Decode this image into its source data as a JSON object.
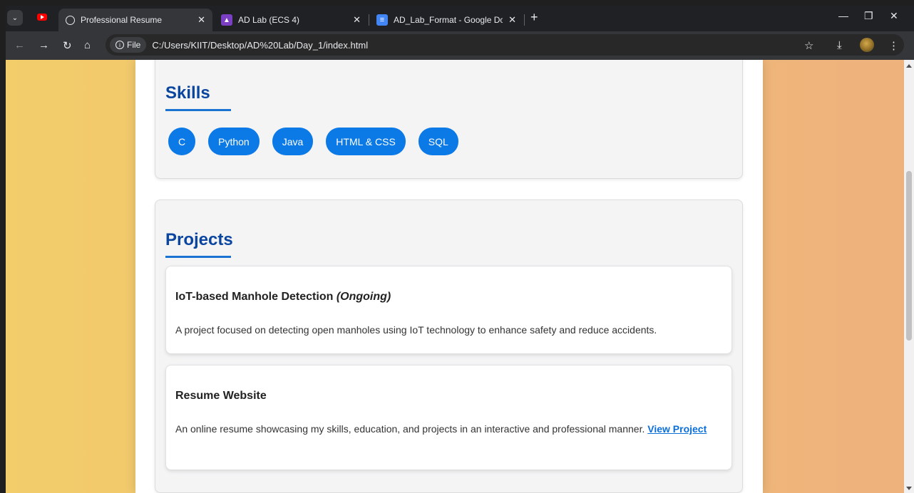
{
  "browser": {
    "tabs": [
      {
        "title": "Professional Resume",
        "active": true
      },
      {
        "title": "AD Lab (ECS 4)",
        "active": false
      },
      {
        "title": "AD_Lab_Format - Google Docs",
        "active": false
      }
    ],
    "address": {
      "chip_label": "File",
      "url": "C:/Users/KIIT/Desktop/AD%20Lab/Day_1/index.html"
    },
    "colors": {
      "chrome_bg": "#202124",
      "toolbar_bg": "#35363a"
    }
  },
  "page": {
    "skills": {
      "heading": "Skills",
      "items": [
        "C",
        "Python",
        "Java",
        "HTML & CSS",
        "SQL"
      ]
    },
    "projects": {
      "heading": "Projects",
      "items": [
        {
          "title": "IoT-based Manhole Detection",
          "status": "(Ongoing)",
          "description": "A project focused on detecting open manholes using IoT technology to enhance safety and reduce accidents."
        },
        {
          "title": "Resume Website",
          "description": "An online resume showcasing my skills, education, and projects in an interactive and professional manner.",
          "link_text": "View Project"
        }
      ]
    },
    "colors": {
      "heading": "#0a46a0",
      "pill_bg": "#0b79e6",
      "link": "#0b6fd8"
    }
  }
}
